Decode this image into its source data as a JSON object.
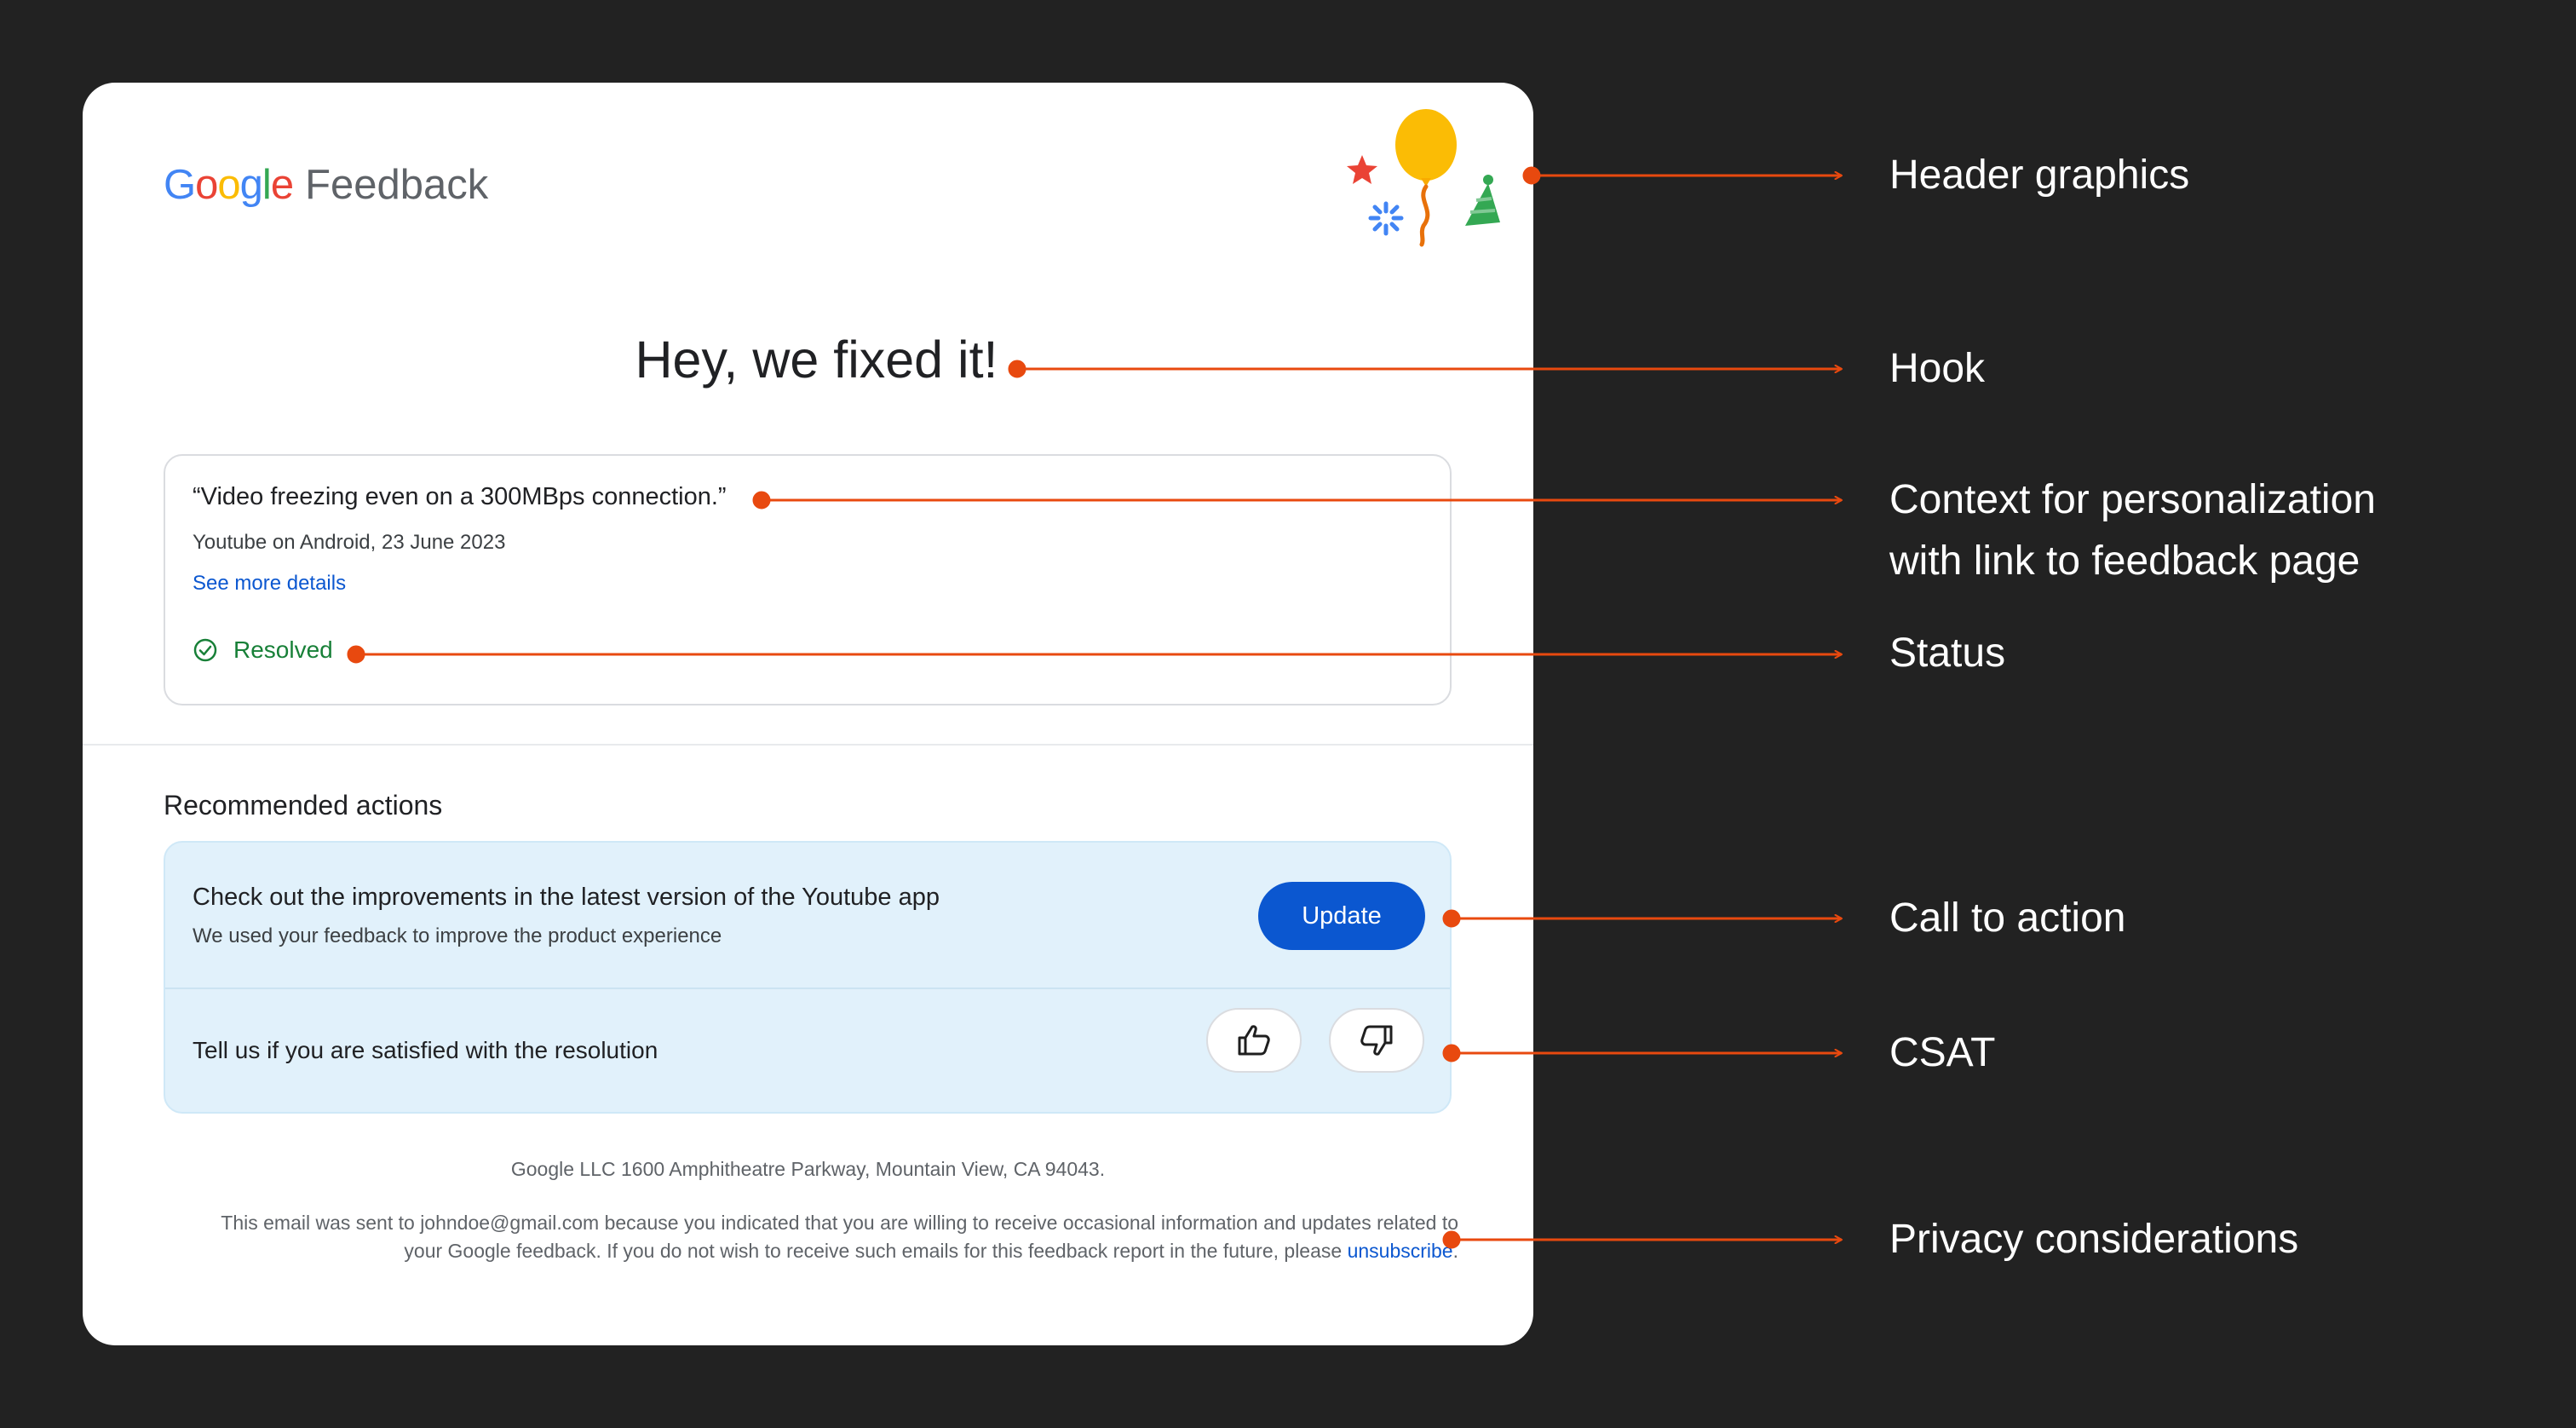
{
  "header": {
    "logo_google": [
      "G",
      "o",
      "o",
      "g",
      "l",
      "e"
    ],
    "logo_colors": [
      "#4285F4",
      "#EA4335",
      "#FBBC05",
      "#4285F4",
      "#34A853",
      "#EA4335"
    ],
    "logo_product": "Feedback"
  },
  "hook": {
    "text": "Hey, we fixed it!"
  },
  "context": {
    "quote": "“Video freezing even on a 300MBps connection.”",
    "meta": "Youtube on Android, 23 June 2023",
    "link_text": "See more details",
    "status": "Resolved"
  },
  "recommended": {
    "title": "Recommended actions",
    "cta_title": "Check out the improvements in the latest version of the Youtube app",
    "cta_subtitle": "We used your feedback to improve the product experience",
    "cta_button": "Update",
    "csat_label": "Tell us if you are satisfied with the resolution"
  },
  "footer": {
    "address": "Google LLC 1600 Amphitheatre Parkway, Mountain View, CA 94043.",
    "privacy_text": "This email was sent to johndoe@gmail.com because you indicated that you are willing to receive occasional information and updates related to your Google feedback. If you do not wish to receive such emails for this feedback report in the future, please",
    "unsubscribe": "unsubscribe",
    "trailing": "."
  },
  "annotations": {
    "header_graphics": "Header graphics",
    "hook": "Hook",
    "context_line1": "Context for personalization",
    "context_line2": "with link to feedback page",
    "status": "Status",
    "cta": "Call to action",
    "csat": "CSAT",
    "privacy": "Privacy considerations"
  },
  "colors": {
    "background": "#222222",
    "accent_annotation": "#E8490F",
    "primary_button": "#0B57D0",
    "resolved_green": "#188038",
    "action_panel": "#E1F1FB"
  },
  "icons": {
    "status": "check-circle-icon",
    "thumbs_up": "thumbs-up-icon",
    "thumbs_down": "thumbs-down-icon",
    "decor": [
      "star-icon",
      "balloon-icon",
      "party-hat-icon",
      "sparkle-icon"
    ]
  }
}
